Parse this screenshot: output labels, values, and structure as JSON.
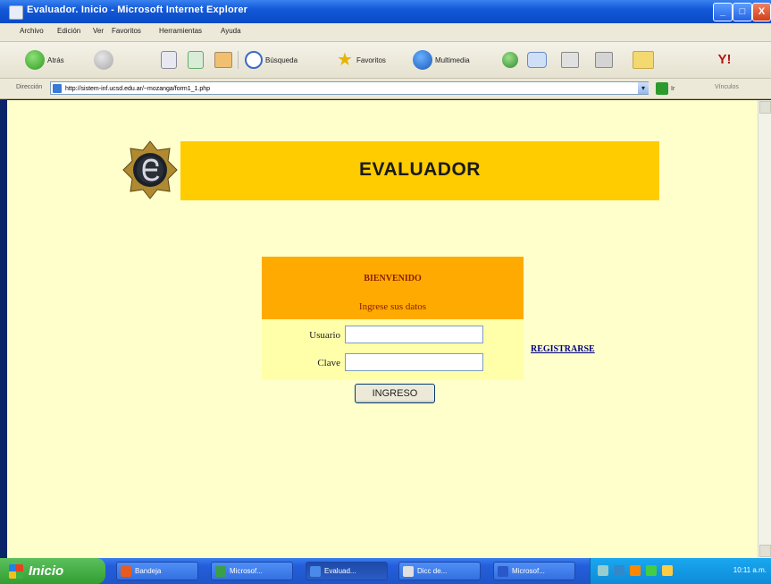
{
  "window": {
    "title": "Evaluador. Inicio - Microsoft Internet Explorer",
    "controls": {
      "minimize": "_",
      "maximize": "□",
      "close": "X"
    }
  },
  "menubar": [
    "Archivo",
    "Edición",
    "Ver",
    "Favoritos",
    "Herramientas",
    "Ayuda"
  ],
  "toolbar": {
    "back": "Atrás",
    "search": "Búsqueda",
    "favorites": "Favoritos",
    "multimedia": "Multimedia"
  },
  "addressbar": {
    "label": "Dirección",
    "url": "http://sistem-inf.ucsd.edu.ar/~mozanga/form1_1.php",
    "go": "Ir",
    "links": "Vínculos"
  },
  "page": {
    "header_title": "EVALUADOR",
    "welcome_title": "BIENVENIDO",
    "welcome_subtitle": "Ingrese sus datos",
    "user_label": "Usuario",
    "password_label": "Clave",
    "submit_label": "INGRESO",
    "register_link": "REGISTRARSE"
  },
  "taskbar": {
    "start": "Inicio",
    "tasks": [
      "Bandeja",
      "Microsof...",
      "Evaluad...",
      "Dicc de...",
      "Microsof..."
    ],
    "clock": "10:11 a.m."
  },
  "colors": {
    "page_background": "#ffffcc",
    "header_bar": "#ffcc00",
    "welcome_box": "#ffaa00",
    "form_area": "#ffffaa",
    "link": "#000080"
  }
}
